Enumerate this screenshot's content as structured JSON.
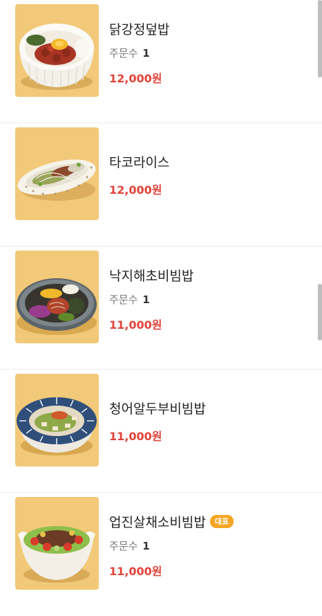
{
  "menu": {
    "order_label": "주문수",
    "items": [
      {
        "name": "닭강정덮밥",
        "orders": "1",
        "price": "12,000원",
        "badge": ""
      },
      {
        "name": "타코라이스",
        "orders": "",
        "price": "12,000원",
        "badge": ""
      },
      {
        "name": "낙지해초비빔밥",
        "orders": "1",
        "price": "11,000원",
        "badge": ""
      },
      {
        "name": "청어알두부비빔밥",
        "orders": "",
        "price": "11,000원",
        "badge": ""
      },
      {
        "name": "업진살채소비빔밥",
        "orders": "1",
        "price": "11,000원",
        "badge": "대표"
      }
    ]
  },
  "colors": {
    "price": "#e0433a",
    "badge": "#f5a623",
    "thumb_background": "#f2c978"
  }
}
